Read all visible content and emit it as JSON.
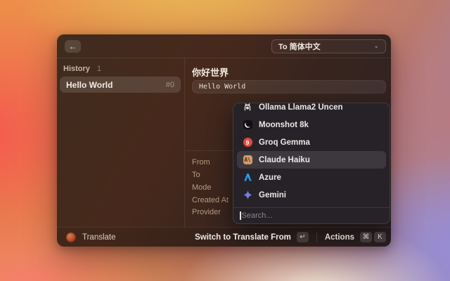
{
  "header": {
    "back_icon": "←",
    "target_language_label": "To 简体中文",
    "chevron_icon": "⌄"
  },
  "sidebar": {
    "section_title": "History",
    "section_count": "1",
    "items": [
      {
        "title": "Hello World",
        "index_badge": "#0"
      }
    ]
  },
  "detail": {
    "translated_text": "你好世界",
    "source_text": "Hello World",
    "metadata": {
      "labels": [
        "From",
        "To",
        "Mode",
        "Created At",
        "Provider"
      ]
    }
  },
  "provider_dropdown": {
    "items": [
      {
        "label": "Ollama Llama2 Uncen"
      },
      {
        "label": "Moonshot 8k"
      },
      {
        "label": "Groq Gemma"
      },
      {
        "label": "Claude Haiku"
      },
      {
        "label": "Azure"
      },
      {
        "label": "Gemini"
      }
    ],
    "selected": "Claude Haiku",
    "search_placeholder": "Search...",
    "groq_glyph": "9",
    "claude_glyph": "A\\"
  },
  "footer": {
    "app_label": "Translate",
    "hint_label": "Switch to Translate From",
    "hint_key": "↵",
    "actions_label": "Actions",
    "actions_keys": [
      "⌘",
      "K"
    ]
  },
  "colors": {
    "claude_orange": "#d29b68",
    "groq_red": "#e5493f",
    "azure_blue": "#2e8ce1",
    "gemini_blue": "#4c8df6",
    "moonshot_black": "#101014"
  }
}
